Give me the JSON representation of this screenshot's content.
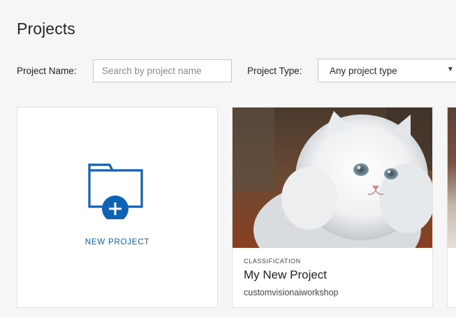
{
  "header": {
    "title": "Projects"
  },
  "filters": {
    "project_name_label": "Project Name:",
    "search_placeholder": "Search by project name",
    "project_type_label": "Project Type:",
    "project_type_value": "Any project type"
  },
  "cards": {
    "new_project_label": "NEW PROJECT",
    "project": {
      "type": "CLASSIFICATION",
      "name": "My New Project",
      "owner": "customvisionaiworkshop"
    }
  },
  "colors": {
    "accent": "#0f62b4",
    "page_bg": "#f6f6f6",
    "card_bg": "#ffffff",
    "border": "#e1e1e1"
  },
  "icons": {
    "new_project": "folder-plus-icon",
    "dropdown": "chevron-down-icon"
  }
}
